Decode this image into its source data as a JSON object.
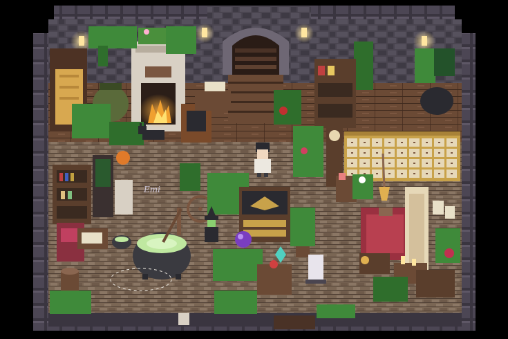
{
  "scene": {
    "signature_text": "Emi",
    "colors": {
      "background": "#000000",
      "wall_stone": "#4a4550",
      "wall_stone_dark": "#2e2a33",
      "floor_wood": "#6b4a35",
      "floor_wood_dark": "#4d3224",
      "floor_stone": "#8a7866",
      "plant_green": "#3f8a3a",
      "plant_dark": "#23522a",
      "potion_green": "#bfe8a0",
      "cauldron": "#3a3a40",
      "fire": "#f0a030",
      "candle_glow": "#ffe6a0",
      "rug_red": "#9a3040",
      "cream_runner": "#e6d8b8",
      "gold_cabinet": "#c8a24a",
      "crystal_teal": "#50d0c0",
      "orb_purple": "#7a3ec0"
    },
    "objects": [
      "stone-fireplace",
      "arched-doorway",
      "brewing-cauldron",
      "witch-character",
      "farmer-character",
      "black-cat",
      "herb-cabinet",
      "bookshelf",
      "spinning-wheel",
      "crystal-ball",
      "grandfather-clock",
      "red-rug",
      "potion-table",
      "wall-sconces",
      "hanging-plants"
    ]
  }
}
